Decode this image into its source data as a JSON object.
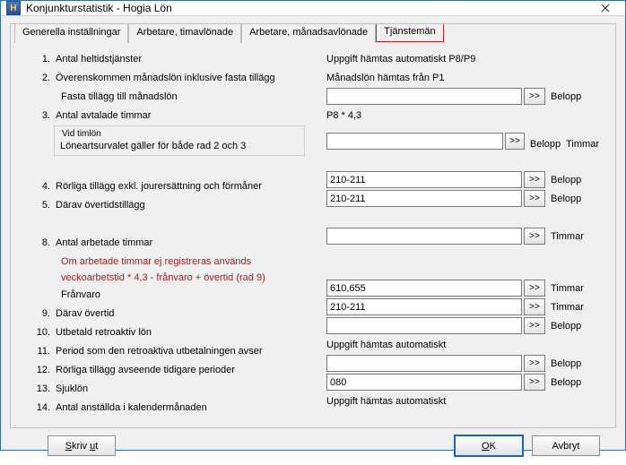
{
  "window": {
    "title": "Konjunkturstatistik - Hogia Lön",
    "icon_text": "H"
  },
  "tabs": {
    "items": [
      {
        "label": "Generella inställningar"
      },
      {
        "label": "Arbetare, timavlönade"
      },
      {
        "label": "Arbetare, månadsavlönade"
      },
      {
        "label": "Tjänstemän"
      }
    ]
  },
  "units": {
    "belopp": "Belopp",
    "timmar": "Timmar"
  },
  "rows": {
    "r1": {
      "num": "1.",
      "label": "Antal heltidstjänster",
      "right_text": "Uppgift hämtas automatiskt P8/P9"
    },
    "r2": {
      "num": "2.",
      "label": "Överenskommen månadslön inklusive fasta tillägg",
      "right_text": "Månadslön hämtas från P1"
    },
    "r2b": {
      "label": "Fasta tillägg till månadslön",
      "value": ""
    },
    "r3": {
      "num": "3.",
      "label": "Antal avtalade timmar",
      "right_text": "P8 * 4,3"
    },
    "r3_box_hdr": "Vid timlön",
    "r3_box_text": "Löneartsurvalet gäller för både rad 2 och 3",
    "r3_box_value": "",
    "r4": {
      "num": "4.",
      "label": "Rörliga tillägg exkl. jourersättning och förmåner",
      "value": "210-211"
    },
    "r5": {
      "num": "5.",
      "label": "Därav övertidstillägg",
      "value": "210-211"
    },
    "r8": {
      "num": "8.",
      "label": "Antal arbetade timmar",
      "value": ""
    },
    "r8_note1": "Om arbetade timmar ej registreras används",
    "r8_note2": "veckoarbetstid * 4,3 - frånvaro + övertid (rad 9)",
    "r8_franvaro_label": "Frånvaro",
    "r8_franvaro_value": "610,655",
    "r9": {
      "num": "9.",
      "label": "Därav övertid",
      "value": "210-211"
    },
    "r10": {
      "num": "10.",
      "label": "Utbetald retroaktiv lön",
      "value": ""
    },
    "r11": {
      "num": "11.",
      "label": "Period som den retroaktiva utbetalningen avser",
      "right_text": "Uppgift hämtas automatiskt"
    },
    "r12": {
      "num": "12.",
      "label": "Rörliga tillägg avseende tidigare perioder",
      "value": ""
    },
    "r13": {
      "num": "13.",
      "label": "Sjuklön",
      "value": "080"
    },
    "r14": {
      "num": "14.",
      "label": "Antal anställda i kalendermånaden",
      "right_text": "Uppgift hämtas automatiskt"
    }
  },
  "buttons": {
    "print": "Skriv ut",
    "ok": "OK",
    "cancel": "Avbryt",
    "expand": ">>"
  }
}
